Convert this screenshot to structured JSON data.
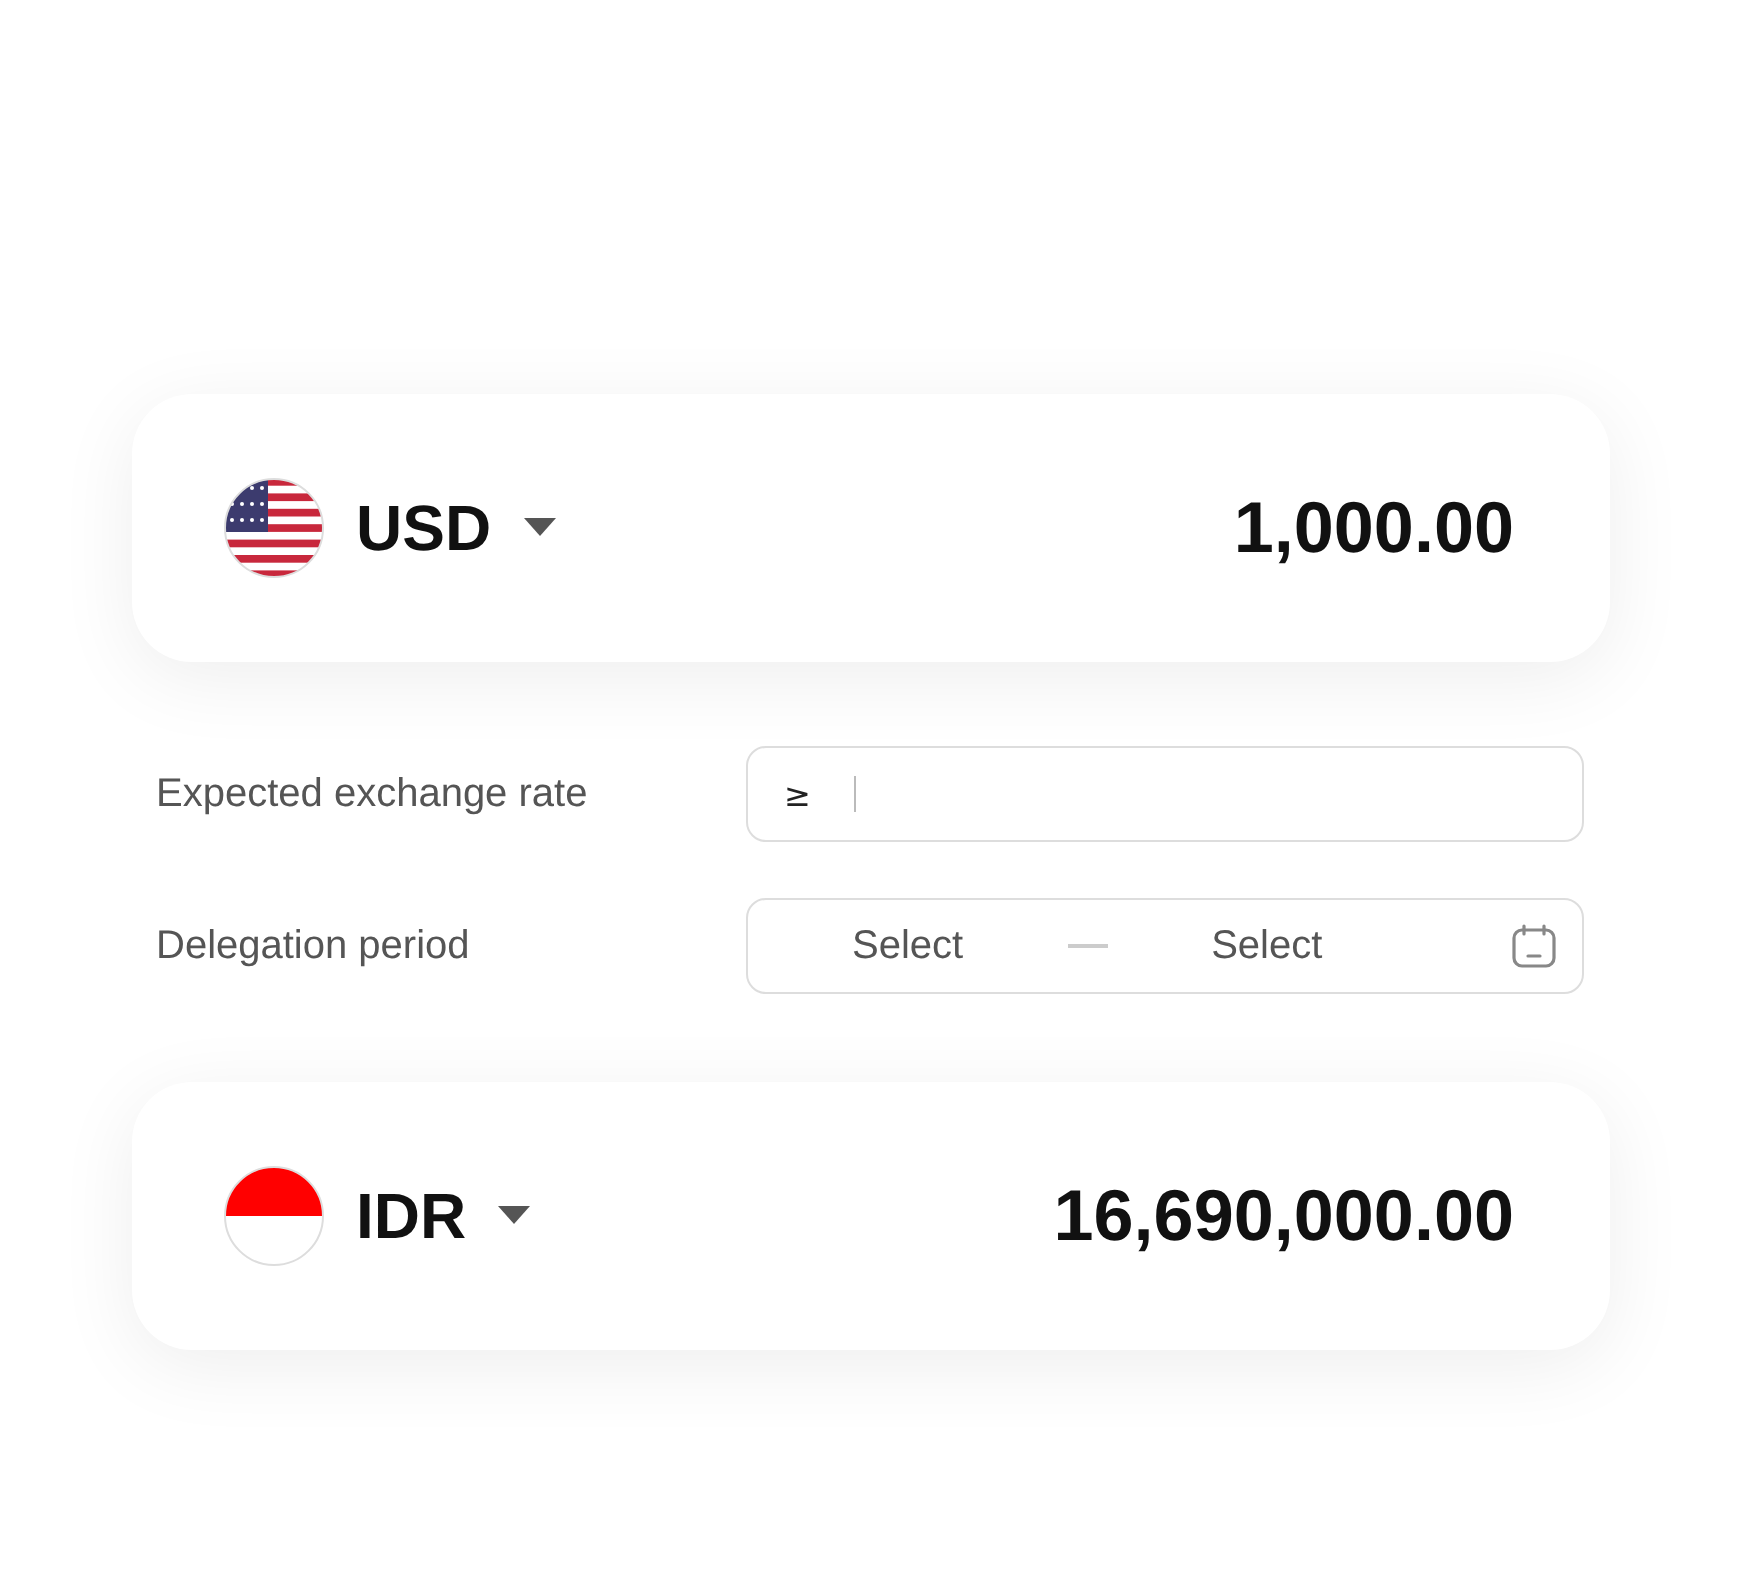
{
  "from": {
    "currency": "USD",
    "kind": "us",
    "amount": "1,000.00"
  },
  "rate_field": {
    "label": "Expected exchange rate",
    "prefix": "≥"
  },
  "period_field": {
    "label": "Delegation period",
    "start_placeholder": "Select",
    "end_placeholder": "Select"
  },
  "to": {
    "currency": "IDR",
    "kind": "id",
    "amount": "16,690,000.00"
  }
}
